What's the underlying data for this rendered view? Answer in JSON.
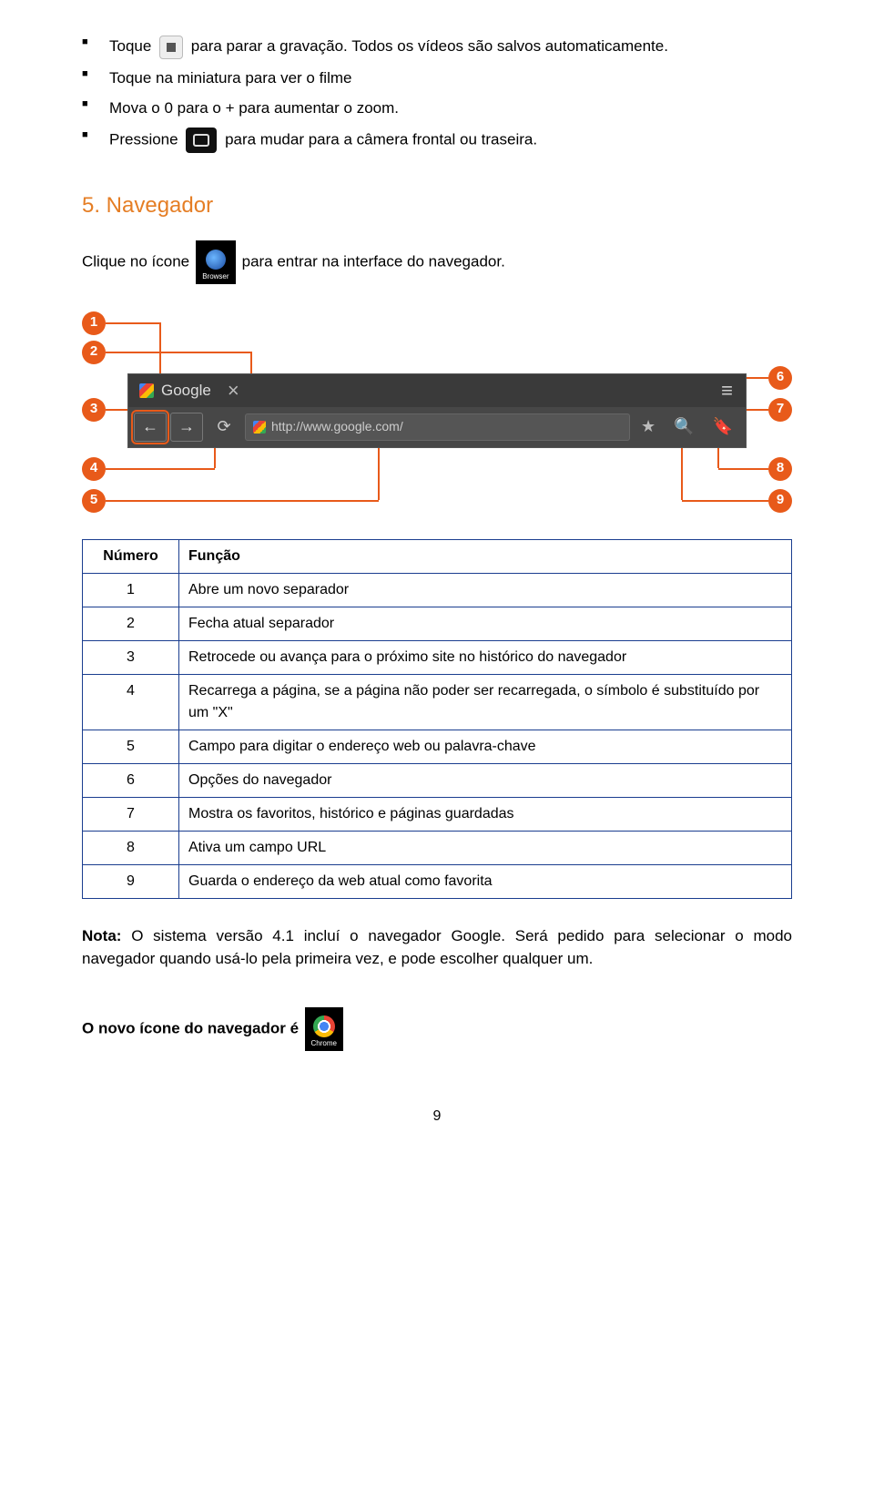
{
  "bullets": {
    "b1a": "Toque ",
    "b1b": " para parar a gravação. Todos os vídeos são salvos automaticamente.",
    "b2": "Toque na miniatura para ver o filme",
    "b3": "Mova o 0 para o + para aumentar o zoom.",
    "b4a": "Pressione ",
    "b4b": " para mudar para a câmera frontal ou traseira."
  },
  "section_title": "5. Navegador",
  "nav_sentence": {
    "a": "Clique no ícone ",
    "b": "para entrar na interface do navegador."
  },
  "browser_icon_label": "Browser",
  "figure": {
    "callouts": [
      "1",
      "2",
      "3",
      "4",
      "5",
      "6",
      "7",
      "8",
      "9"
    ],
    "tab_label": "Google",
    "url": "http://www.google.com/"
  },
  "table": {
    "head": {
      "num": "Número",
      "func": "Função"
    },
    "rows": [
      {
        "n": "1",
        "f": "Abre um novo separador"
      },
      {
        "n": "2",
        "f": "Fecha atual separador"
      },
      {
        "n": "3",
        "f": "Retrocede ou avança para o próximo site no histórico do navegador"
      },
      {
        "n": "4",
        "f": "Recarrega a página, se a página não poder ser recarregada, o símbolo é substituído por um \"X\""
      },
      {
        "n": "5",
        "f": "Campo para digitar o endereço web ou palavra-chave"
      },
      {
        "n": "6",
        "f": "Opções do navegador"
      },
      {
        "n": "7",
        "f": "Mostra os favoritos, histórico e páginas guardadas"
      },
      {
        "n": "8",
        "f": "Ativa um campo URL"
      },
      {
        "n": "9",
        "f": "Guarda o endereço da web atual como favorita"
      }
    ]
  },
  "note": {
    "lead": "Nota: ",
    "body": "O sistema versão 4.1 incluí o navegador Google. Será pedido para selecionar o modo navegador quando usá-lo pela primeira vez, e pode escolher qualquer um."
  },
  "chrome_line": "O novo ícone do navegador é ",
  "chrome_icon_label": "Chrome",
  "page_number": "9"
}
